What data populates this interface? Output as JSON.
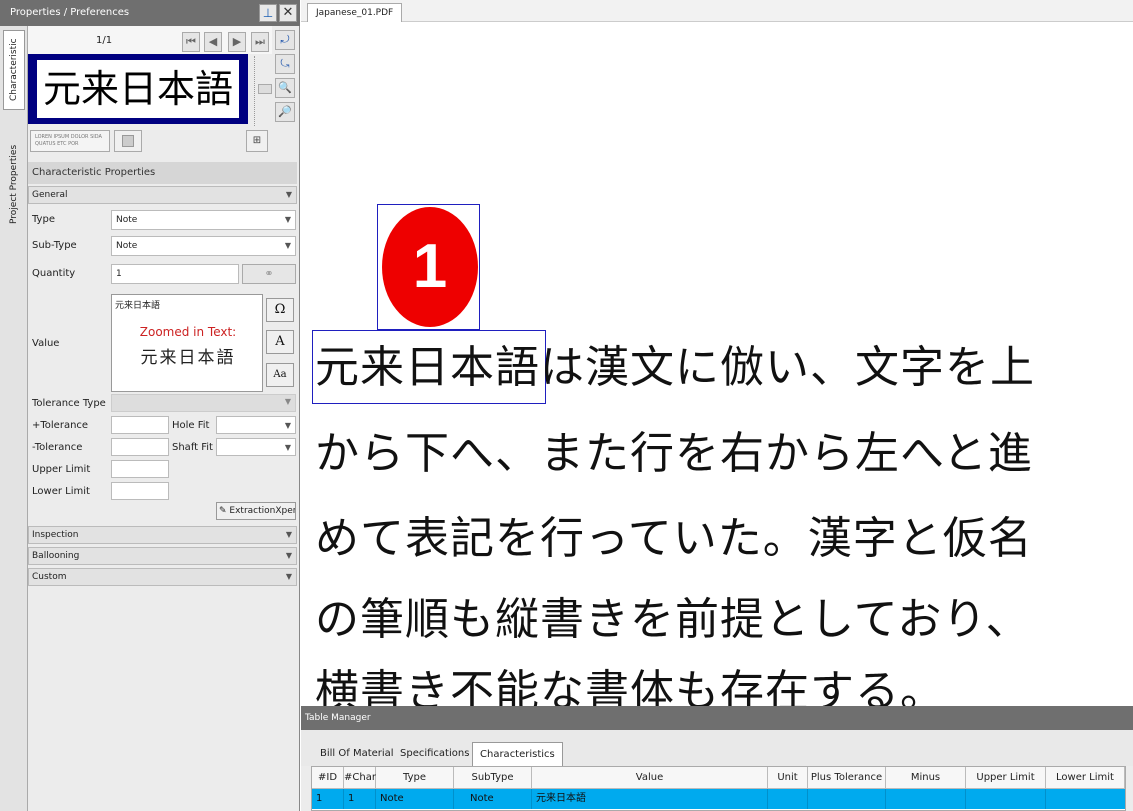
{
  "left_panel": {
    "title": "Properties / Preferences",
    "pin_icon": "pin-icon",
    "close_icon": "close-icon",
    "vertical_tabs": [
      "Characteristic",
      "Project Properties"
    ],
    "page_indicator": "1/1",
    "preview_text": "元来日本語",
    "thumbnail_text": "LOREN IPSUM DOLOR SIDA QUATUS ETC POR",
    "section_title": "Characteristic Properties",
    "groups": {
      "general": "General",
      "inspection": "Inspection",
      "ballooning": "Ballooning",
      "custom": "Custom"
    },
    "fields": {
      "type_label": "Type",
      "type_value": "Note",
      "subtype_label": "Sub-Type",
      "subtype_value": "Note",
      "quantity_label": "Quantity",
      "quantity_value": "1",
      "value_label": "Value",
      "value_text": "元来日本語",
      "zoomed_label": "Zoomed in Text:",
      "zoomed_text": "元来日本語",
      "tolerance_type_label": "Tolerance Type",
      "plus_tolerance_label": "+Tolerance",
      "minus_tolerance_label": "-Tolerance",
      "hole_fit_label": "Hole Fit",
      "shaft_fit_label": "Shaft Fit",
      "upper_limit_label": "Upper Limit",
      "lower_limit_label": "Lower Limit"
    },
    "value_buttons": [
      "Ω",
      "A",
      "Aa"
    ],
    "extraction_button": "ExtractionXpert"
  },
  "document": {
    "tab_label": "Japanese_01.PDF",
    "balloon_number": "1",
    "balloon_color": "#ee0000",
    "lines": [
      "元来日本語は漢文に倣い、文字を上",
      "から下へ、また行を右から左へと進",
      "めて表記を行っていた。漢字と仮名",
      "の筆順も縦書きを前提としており、",
      "横書き不能な書体も存在する。"
    ]
  },
  "table_manager": {
    "title": "Table Manager",
    "tabs": [
      "Bill Of Material",
      "Specifications",
      "Characteristics"
    ],
    "active_tab": "Characteristics",
    "columns": [
      "#ID",
      "#Char",
      "Type",
      "SubType",
      "Value",
      "Unit",
      "Plus Tolerance",
      "Minus Tolerance",
      "Upper Limit",
      "Lower Limit"
    ],
    "rows": [
      [
        "1",
        "1",
        "Note",
        "Note",
        "元来日本語",
        "",
        "",
        "",
        "",
        ""
      ]
    ],
    "selected_row_color": "#00aaee"
  }
}
